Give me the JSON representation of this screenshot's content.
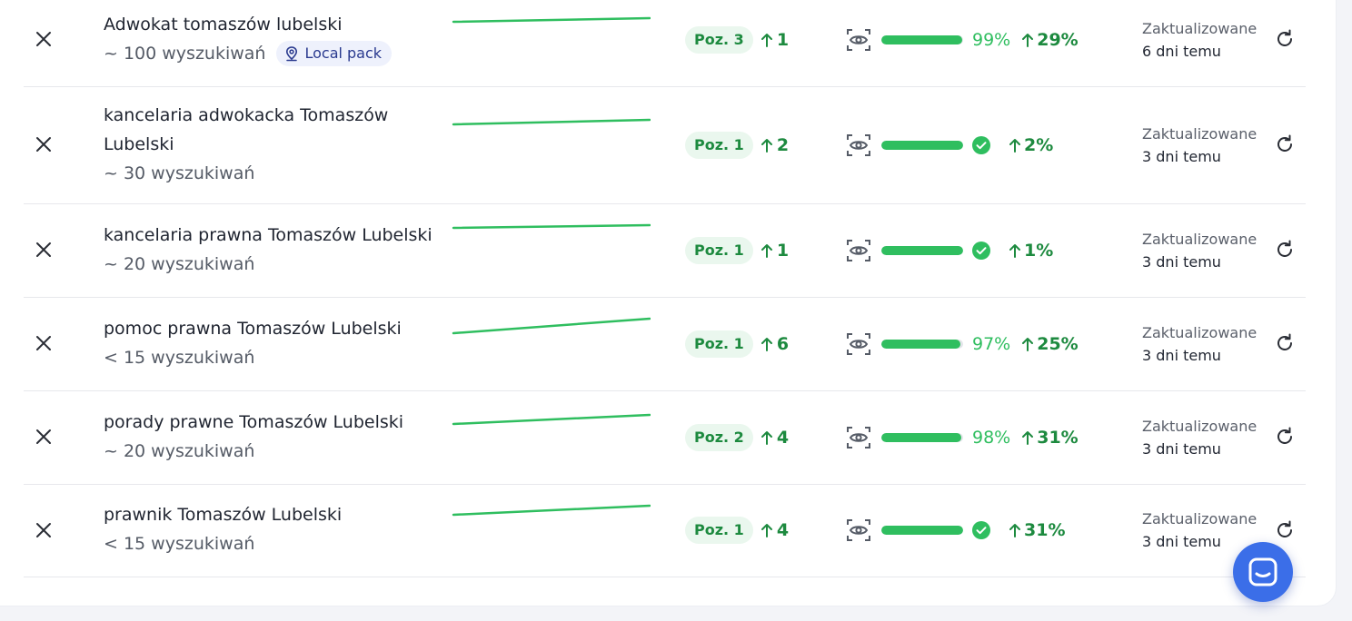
{
  "colors": {
    "accent_green": "#2fbe5f",
    "badge_blue": "#eef1fc",
    "chat_blue": "#3b6ee8"
  },
  "icons": {
    "remove": "close-icon",
    "visibility": "eye-icon",
    "refresh": "refresh-icon",
    "location": "map-pin-icon",
    "done": "check-circle-icon",
    "chat": "chat-icon"
  },
  "rows": [
    {
      "keyword": "Adwokat tomaszów lubelski",
      "searches": "~ 100 wyszukiwań",
      "badge": "Local pack",
      "position": "Poz. 3",
      "position_change": "1",
      "visibility": 0.99,
      "visibility_text": "99%",
      "visibility_change": "29%",
      "updated_label": "Zaktualizowane",
      "updated_value": "6 dni temu"
    },
    {
      "keyword": "kancelaria adwokacka Tomaszów Lubelski",
      "searches": "~ 30 wyszukiwań",
      "position": "Poz. 1",
      "position_change": "2",
      "visibility": 1.0,
      "visibility_text": "",
      "visibility_change": "2%",
      "updated_label": "Zaktualizowane",
      "updated_value": "3 dni temu"
    },
    {
      "keyword": "kancelaria prawna Tomaszów Lubelski",
      "searches": "~ 20 wyszukiwań",
      "position": "Poz. 1",
      "position_change": "1",
      "visibility": 1.0,
      "visibility_text": "",
      "visibility_change": "1%",
      "updated_label": "Zaktualizowane",
      "updated_value": "3 dni temu"
    },
    {
      "keyword": "pomoc prawna Tomaszów Lubelski",
      "searches": "< 15 wyszukiwań",
      "position": "Poz. 1",
      "position_change": "6",
      "visibility": 0.97,
      "visibility_text": "97%",
      "visibility_change": "25%",
      "updated_label": "Zaktualizowane",
      "updated_value": "3 dni temu"
    },
    {
      "keyword": "porady prawne Tomaszów Lubelski",
      "searches": "~ 20 wyszukiwań",
      "position": "Poz. 2",
      "position_change": "4",
      "visibility": 0.98,
      "visibility_text": "98%",
      "visibility_change": "31%",
      "updated_label": "Zaktualizowane",
      "updated_value": "3 dni temu"
    },
    {
      "keyword": "prawnik Tomaszów Lubelski",
      "searches": "< 15 wyszukiwań",
      "position": "Poz. 1",
      "position_change": "4",
      "visibility": 1.0,
      "visibility_text": "",
      "visibility_change": "31%",
      "updated_label": "Zaktualizowane",
      "updated_value": "3 dni temu"
    }
  ]
}
